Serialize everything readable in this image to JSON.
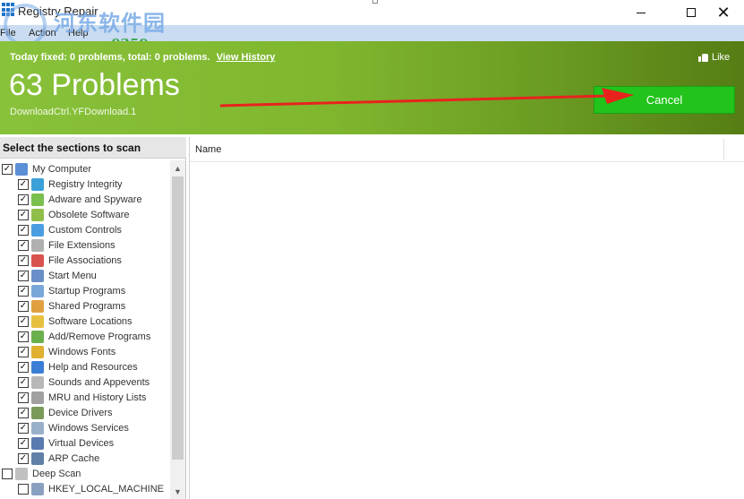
{
  "window": {
    "title": "Registry Repair",
    "watermark": {
      "site_cn": "河东软件园",
      "url": "www.pc0359.cn"
    },
    "controls": {
      "minimize": "—",
      "maximize": "☐",
      "close": "✕"
    }
  },
  "menu": {
    "file": "File",
    "action": "Action",
    "help": "Help"
  },
  "banner": {
    "fixed_text": "Today fixed: 0 problems, total: 0 problems.",
    "history_link": "View History",
    "like": "Like",
    "problems": "63 Problems",
    "current_item": "DownloadCtrl.YFDownload.1",
    "cancel": "Cancel",
    "colors": {
      "green_start": "#88c23a",
      "green_end": "#557d14",
      "cancel_bg": "#22c31b",
      "arrow": "#e8231d"
    }
  },
  "sections": {
    "header": "Select the sections to scan",
    "tree": [
      {
        "label": "My Computer",
        "checked": true,
        "level": 0,
        "icon": "computer-icon",
        "color": "#5b8fd6"
      },
      {
        "label": "Registry Integrity",
        "checked": true,
        "level": 1,
        "icon": "registry-icon",
        "color": "#3aa0d8"
      },
      {
        "label": "Adware and Spyware",
        "checked": true,
        "level": 1,
        "icon": "adware-icon",
        "color": "#7ac04e"
      },
      {
        "label": "Obsolete Software",
        "checked": true,
        "level": 1,
        "icon": "trash-icon",
        "color": "#8fbf4a"
      },
      {
        "label": "Custom Controls",
        "checked": true,
        "level": 1,
        "icon": "controls-icon",
        "color": "#4a9de0"
      },
      {
        "label": "File Extensions",
        "checked": true,
        "level": 1,
        "icon": "file-icon",
        "color": "#b0b0b0"
      },
      {
        "label": "File Associations",
        "checked": true,
        "level": 1,
        "icon": "associations-icon",
        "color": "#d9534f"
      },
      {
        "label": "Start Menu",
        "checked": true,
        "level": 1,
        "icon": "start-menu-icon",
        "color": "#6a8fc8"
      },
      {
        "label": "Startup Programs",
        "checked": true,
        "level": 1,
        "icon": "startup-icon",
        "color": "#7aa7d9"
      },
      {
        "label": "Shared Programs",
        "checked": true,
        "level": 1,
        "icon": "shared-icon",
        "color": "#e0a040"
      },
      {
        "label": "Software Locations",
        "checked": true,
        "level": 1,
        "icon": "software-location-icon",
        "color": "#e8c040"
      },
      {
        "label": "Add/Remove Programs",
        "checked": true,
        "level": 1,
        "icon": "add-remove-icon",
        "color": "#6ab04c"
      },
      {
        "label": "Windows Fonts",
        "checked": true,
        "level": 1,
        "icon": "fonts-icon",
        "color": "#e0b030"
      },
      {
        "label": "Help and Resources",
        "checked": true,
        "level": 1,
        "icon": "help-icon",
        "color": "#3b7ed6"
      },
      {
        "label": "Sounds and Appevents",
        "checked": true,
        "level": 1,
        "icon": "sound-icon",
        "color": "#b8b8b8"
      },
      {
        "label": "MRU and History Lists",
        "checked": true,
        "level": 1,
        "icon": "history-icon",
        "color": "#a0a0a0"
      },
      {
        "label": "Device Drivers",
        "checked": true,
        "level": 1,
        "icon": "driver-icon",
        "color": "#7a9a5a"
      },
      {
        "label": "Windows Services",
        "checked": true,
        "level": 1,
        "icon": "services-icon",
        "color": "#9ab0c8"
      },
      {
        "label": "Virtual Devices",
        "checked": true,
        "level": 1,
        "icon": "virtual-device-icon",
        "color": "#5a7ab0"
      },
      {
        "label": "ARP Cache",
        "checked": true,
        "level": 1,
        "icon": "arp-icon",
        "color": "#6080a8"
      },
      {
        "label": "Deep Scan",
        "checked": false,
        "level": 0,
        "icon": "deep-scan-icon",
        "color": "#c0c0c0"
      },
      {
        "label": "HKEY_LOCAL_MACHINE",
        "checked": false,
        "level": 1,
        "icon": "hive-icon",
        "color": "#8aa0c0"
      }
    ]
  },
  "results": {
    "column_name": "Name"
  },
  "scrollbar": {
    "up": "▲",
    "down": "▼"
  }
}
